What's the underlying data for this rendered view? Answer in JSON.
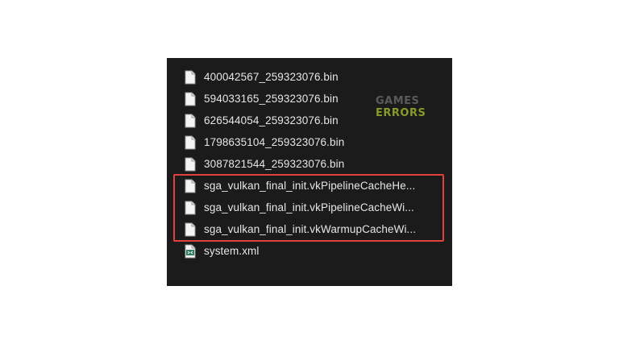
{
  "files": [
    {
      "name": "400042567_259323076.bin",
      "icon": "blank-file-icon"
    },
    {
      "name": "594033165_259323076.bin",
      "icon": "blank-file-icon"
    },
    {
      "name": "626544054_259323076.bin",
      "icon": "blank-file-icon"
    },
    {
      "name": "1798635104_259323076.bin",
      "icon": "blank-file-icon"
    },
    {
      "name": "3087821544_259323076.bin",
      "icon": "blank-file-icon"
    },
    {
      "name": "sga_vulkan_final_init.vkPipelineCacheHe...",
      "icon": "blank-file-icon"
    },
    {
      "name": "sga_vulkan_final_init.vkPipelineCacheWi...",
      "icon": "blank-file-icon"
    },
    {
      "name": "sga_vulkan_final_init.vkWarmupCacheWi...",
      "icon": "blank-file-icon"
    },
    {
      "name": "system.xml",
      "icon": "xml-file-icon"
    }
  ],
  "watermark": {
    "line1": "GAMES",
    "line2": "ERRORS"
  },
  "colors": {
    "panel_background": "#1b1b1b",
    "text": "#e6e6e6",
    "highlight": "#e0413f",
    "watermark_accent": "#8a9a2a"
  }
}
